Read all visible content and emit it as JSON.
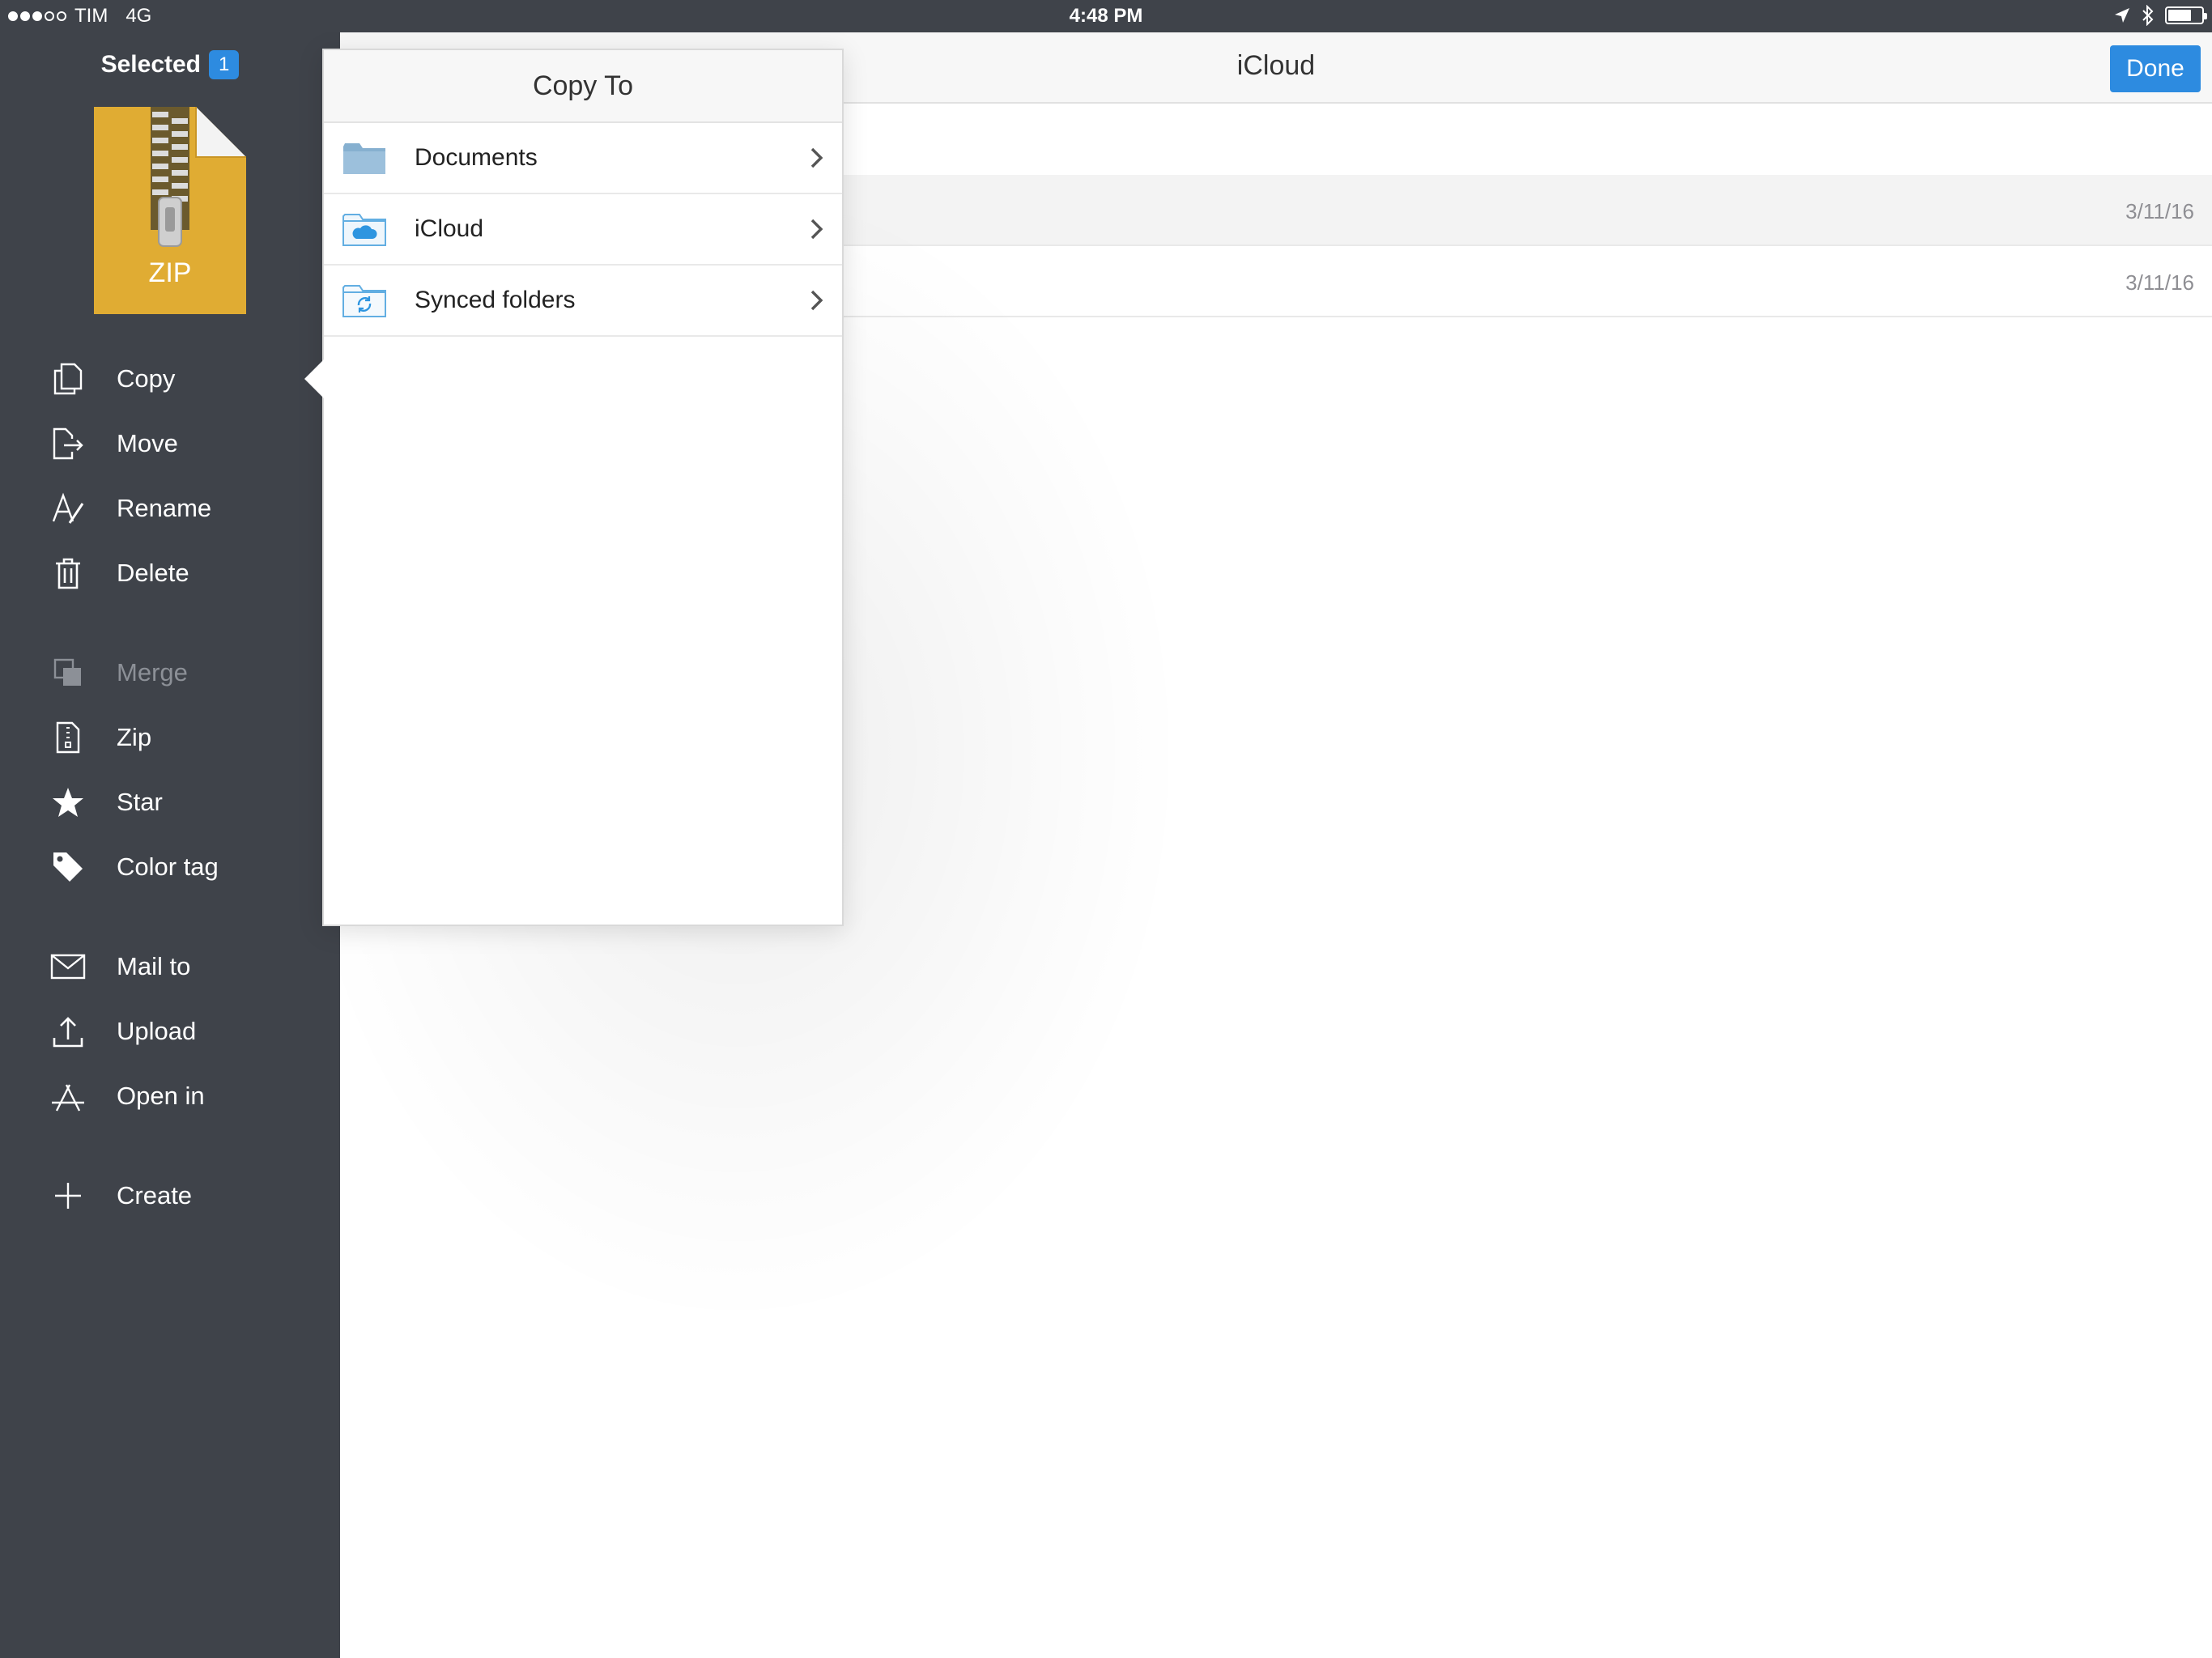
{
  "status_bar": {
    "carrier": "TIM",
    "network": "4G",
    "time": "4:48 PM"
  },
  "sidebar": {
    "selected_label": "Selected",
    "selected_count": "1",
    "file_type_label": "ZIP",
    "items": [
      {
        "label": "Copy",
        "icon": "copy-icon",
        "enabled": true
      },
      {
        "label": "Move",
        "icon": "move-icon",
        "enabled": true
      },
      {
        "label": "Rename",
        "icon": "rename-icon",
        "enabled": true
      },
      {
        "label": "Delete",
        "icon": "trash-icon",
        "enabled": true
      },
      {
        "label": "Merge",
        "icon": "merge-icon",
        "enabled": false
      },
      {
        "label": "Zip",
        "icon": "zip-icon",
        "enabled": true
      },
      {
        "label": "Star",
        "icon": "star-icon",
        "enabled": true
      },
      {
        "label": "Color tag",
        "icon": "tag-icon",
        "enabled": true
      },
      {
        "label": "Mail to",
        "icon": "mail-icon",
        "enabled": true
      },
      {
        "label": "Upload",
        "icon": "upload-icon",
        "enabled": true
      },
      {
        "label": "Open in",
        "icon": "open-in-icon",
        "enabled": true
      },
      {
        "label": "Create",
        "icon": "plus-icon",
        "enabled": true
      }
    ]
  },
  "main": {
    "title": "iCloud",
    "done_label": "Done",
    "rows": [
      {
        "date": "3/11/16"
      },
      {
        "date": "3/11/16"
      }
    ]
  },
  "popover": {
    "title": "Copy To",
    "items": [
      {
        "label": "Documents",
        "icon": "folder-icon"
      },
      {
        "label": "iCloud",
        "icon": "icloud-folder-icon"
      },
      {
        "label": "Synced folders",
        "icon": "sync-folder-icon"
      }
    ]
  },
  "colors": {
    "sidebar_bg": "#3f434a",
    "accent": "#2d8be0",
    "zip_gold": "#e0ac33"
  }
}
